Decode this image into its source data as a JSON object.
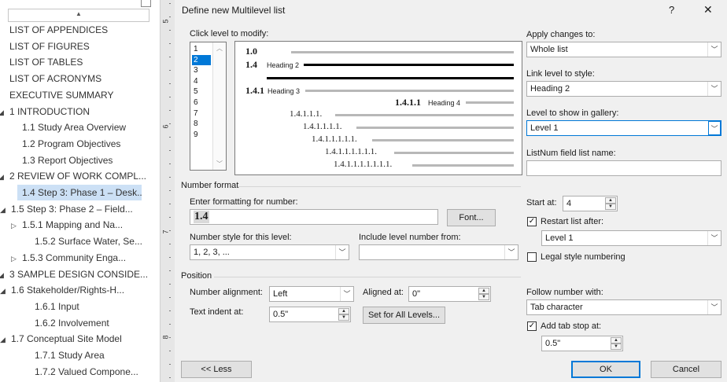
{
  "nav": {
    "items": [
      {
        "label": "LIST OF APPENDICES",
        "indent": 0,
        "tri": ""
      },
      {
        "label": "LIST OF FIGURES",
        "indent": 0,
        "tri": ""
      },
      {
        "label": "LIST OF TABLES",
        "indent": 0,
        "tri": ""
      },
      {
        "label": "LIST OF ACRONYMS",
        "indent": 0,
        "tri": ""
      },
      {
        "label": "EXECUTIVE SUMMARY",
        "indent": 0,
        "tri": ""
      },
      {
        "label": "1 INTRODUCTION",
        "indent": 0,
        "tri": "◢"
      },
      {
        "label": "1.1 Study Area Overview",
        "indent": 2,
        "tri": ""
      },
      {
        "label": "1.2 Program Objectives",
        "indent": 2,
        "tri": ""
      },
      {
        "label": "1.3 Report Objectives",
        "indent": 2,
        "tri": ""
      },
      {
        "label": "2 REVIEW OF WORK COMPL...",
        "indent": 0,
        "tri": "◢"
      },
      {
        "label": "1.4 Step 3: Phase 1 – Desk...",
        "indent": 2,
        "tri": "",
        "selected": true
      },
      {
        "label": "1.5 Step 3: Phase 2 – Field...",
        "indent": 1,
        "tri": "◢"
      },
      {
        "label": "1.5.1 Mapping and Na...",
        "indent": 2,
        "tri": "▷"
      },
      {
        "label": "1.5.2 Surface Water, Se...",
        "indent": 3,
        "tri": ""
      },
      {
        "label": "1.5.3 Community Enga...",
        "indent": 2,
        "tri": "▷"
      },
      {
        "label": "3 SAMPLE DESIGN CONSIDE...",
        "indent": 0,
        "tri": "◢"
      },
      {
        "label": "1.6 Stakeholder/Rights-H...",
        "indent": 1,
        "tri": "◢"
      },
      {
        "label": "1.6.1 Input",
        "indent": 3,
        "tri": ""
      },
      {
        "label": "1.6.2 Involvement",
        "indent": 3,
        "tri": ""
      },
      {
        "label": "1.7 Conceptual Site Model",
        "indent": 1,
        "tri": "◢"
      },
      {
        "label": "1.7.1 Study Area",
        "indent": 3,
        "tri": ""
      },
      {
        "label": "1.7.2 Valued Compone...",
        "indent": 3,
        "tri": ""
      }
    ]
  },
  "ruler": {
    "numbers": [
      "5",
      "6",
      "7",
      "8"
    ]
  },
  "dialog": {
    "title": "Define new Multilevel list",
    "help": "?",
    "close": "✕",
    "click_level": "Click level to modify:",
    "levels": [
      "1",
      "2",
      "3",
      "4",
      "5",
      "6",
      "7",
      "8",
      "9"
    ],
    "selected_level": "2",
    "preview": {
      "l1": "1.0",
      "l2num": "1.4",
      "l2text": "Heading 2",
      "l3num": "1.4.1",
      "l3text": "Heading 3",
      "l4num": "1.4.1.1",
      "l4text": "Heading 4",
      "r5": "1.4.1.1.1.",
      "r6": "1.4.1.1.1.1.",
      "r7": "1.4.1.1.1.1.1.",
      "r8": "1.4.1.1.1.1.1.1.",
      "r9": "1.4.1.1.1.1.1.1.1."
    },
    "apply_changes_label": "Apply changes to:",
    "apply_changes_value": "Whole list",
    "link_level_label": "Link level to style:",
    "link_level_value": "Heading 2",
    "gallery_label": "Level to show in gallery:",
    "gallery_value": "Level 1",
    "listnum_label": "ListNum field list name:",
    "listnum_value": "",
    "number_format_title": "Number format",
    "enter_formatting_label": "Enter formatting for number:",
    "formatting_value": "1.4",
    "font_button": "Font...",
    "number_style_label": "Number style for this level:",
    "number_style_value": "1, 2, 3, ...",
    "include_level_label": "Include level number from:",
    "include_level_value": "",
    "start_at_label": "Start at:",
    "start_at_value": "4",
    "restart_label": "Restart list after:",
    "restart_value": "Level 1",
    "legal_label": "Legal style numbering",
    "position_title": "Position",
    "alignment_label": "Number alignment:",
    "alignment_value": "Left",
    "aligned_at_label": "Aligned at:",
    "aligned_at_value": "0\"",
    "indent_label": "Text indent at:",
    "indent_value": "0.5\"",
    "set_all_button": "Set for All Levels...",
    "follow_label": "Follow number with:",
    "follow_value": "Tab character",
    "tab_stop_label": "Add tab stop at:",
    "tab_stop_value": "0.5\"",
    "less_button": "<< Less",
    "ok_button": "OK",
    "cancel_button": "Cancel",
    "check_mark": "✓"
  }
}
